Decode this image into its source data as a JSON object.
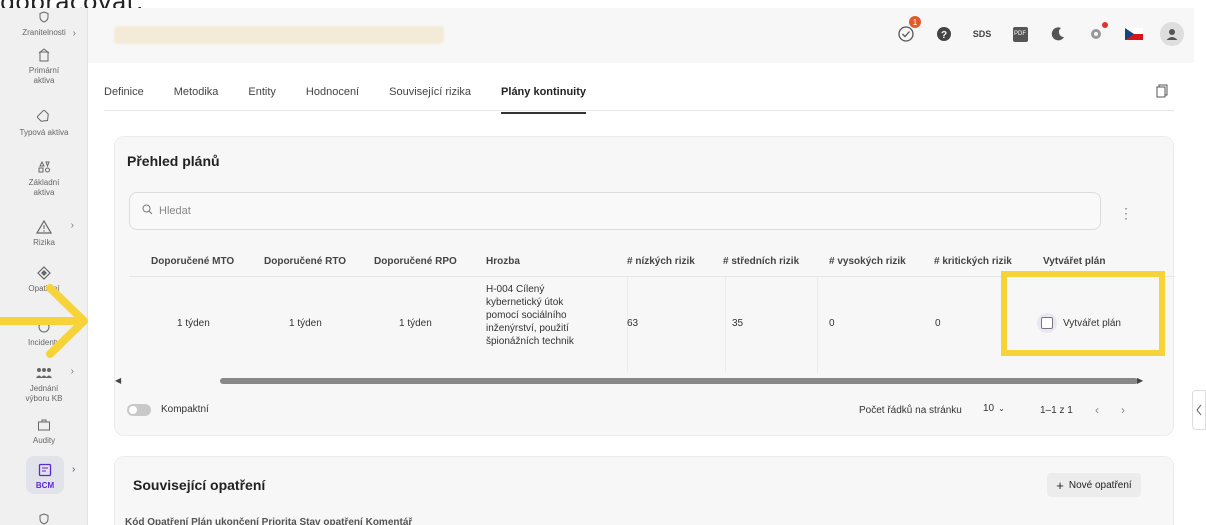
{
  "top_caption": "dopracovat.",
  "sidebar": {
    "items": [
      {
        "label": "Zranitelnosti",
        "icon": "shield-icon"
      },
      {
        "label": "Primární\naktiva",
        "icon": "building-icon"
      },
      {
        "label": "Typová aktiva",
        "icon": "tag-icon"
      },
      {
        "label": "Základní\naktiva",
        "icon": "shapes-icon"
      },
      {
        "label": "Rizika",
        "icon": "warning-icon"
      },
      {
        "label": "Opatření",
        "icon": "diamond-icon"
      },
      {
        "label": "Incidenty",
        "icon": "incident-icon"
      },
      {
        "label": "Jednání\nvýboru KB",
        "icon": "people-icon"
      },
      {
        "label": "Audity",
        "icon": "briefcase-icon"
      },
      {
        "label": "BCM",
        "icon": "bcm-icon"
      },
      {
        "label": "",
        "icon": "shield-icon"
      }
    ]
  },
  "header": {
    "notification_count": "1",
    "sds_label": "SDS",
    "pdf_label": "PDF"
  },
  "tabs": [
    {
      "label": "Definice"
    },
    {
      "label": "Metodika"
    },
    {
      "label": "Entity"
    },
    {
      "label": "Hodnocení"
    },
    {
      "label": "Související rizika"
    },
    {
      "label": "Plány kontinuity"
    }
  ],
  "plans_card": {
    "title": "Přehled plánů",
    "search_placeholder": "Hledat",
    "columns": [
      "Doporučené MTO",
      "Doporučené RTO",
      "Doporučené RPO",
      "Hrozba",
      "# nízkých rizik",
      "# středních rizik",
      "# vysokých rizik",
      "# kritických rizik",
      "Vytvářet plán"
    ],
    "row": {
      "mto": "1 týden",
      "rto": "1 týden",
      "rpo": "1 týden",
      "hrozba": "H-004 Cílený kybernetický útok pomocí sociálního inženýrství, použití špionážních technik",
      "low": "63",
      "medium": "35",
      "high": "0",
      "critical": "0",
      "create_plan_label": "Vytvářet plán"
    },
    "compact_label": "Kompaktní",
    "rows_per_page_label": "Počet řádků na stránku",
    "rows_per_page_value": "10",
    "page_info": "1–1 z 1"
  },
  "measures_card": {
    "title": "Související opatření",
    "new_button_label": "Nové opatření",
    "columns_visible": "Kód   Opatření   Plán ukončení   Priorita   Stav opatření   Komentář"
  }
}
